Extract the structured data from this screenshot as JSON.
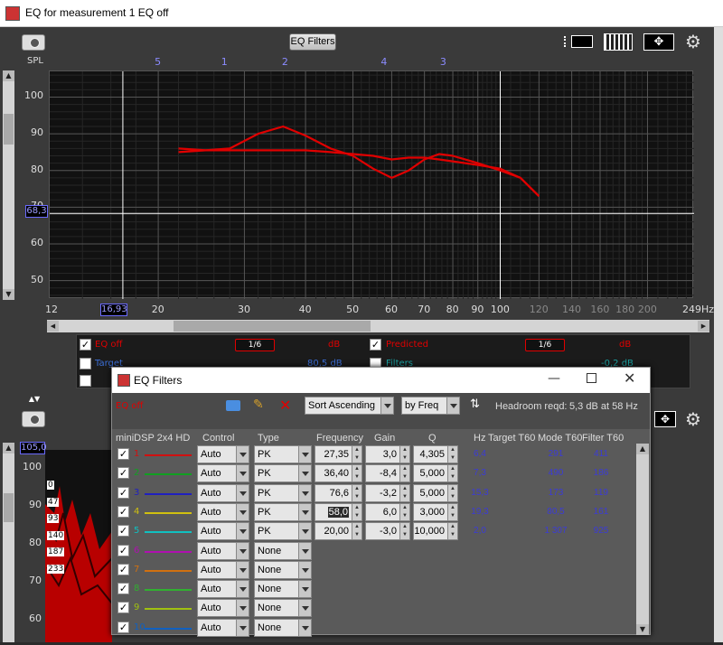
{
  "window": {
    "title": "EQ for measurement 1 EQ off"
  },
  "toolbar": {
    "eq_filters_label": "EQ Filters"
  },
  "graph": {
    "y_axis_title": "SPL",
    "y_ticks": [
      "100",
      "90",
      "80",
      "70",
      "60",
      "50"
    ],
    "x_ticks": [
      "12",
      "20",
      "30",
      "40",
      "50",
      "60",
      "70",
      "80",
      "90",
      "100",
      "120",
      "140",
      "160",
      "180",
      "200",
      "249Hz"
    ],
    "cursor_x_label": "16,93",
    "cursor_y_label": "68,3",
    "filter_markers": [
      "5",
      "1",
      "2",
      "4",
      "3"
    ],
    "colors": {
      "eq_off": "#e00000",
      "predicted": "#e00000",
      "cursor": "#ffffff",
      "markers": "#8b8bff"
    }
  },
  "chart_data": {
    "type": "line",
    "xlabel": "",
    "ylabel": "SPL",
    "xscale": "log",
    "xlim": [
      12,
      249
    ],
    "ylim": [
      45,
      107
    ],
    "grid": true,
    "series": [
      {
        "name": "EQ off",
        "x": [
          22,
          25,
          28,
          32,
          36,
          40,
          45,
          50,
          55,
          60,
          65,
          70,
          75,
          80,
          90,
          100,
          110,
          120
        ],
        "y": [
          86,
          85.5,
          86,
          90,
          92,
          89.5,
          86,
          84,
          80.5,
          78,
          80,
          83,
          84.5,
          84,
          82,
          80,
          78,
          73
        ]
      },
      {
        "name": "Predicted",
        "x": [
          22,
          25,
          28,
          32,
          36,
          40,
          45,
          50,
          55,
          60,
          65,
          70,
          75,
          80,
          90,
          100,
          110,
          120
        ],
        "y": [
          85,
          85.5,
          85.5,
          85.5,
          85.5,
          85.5,
          85,
          84.5,
          84,
          83,
          83.5,
          83.5,
          83,
          82.5,
          81.5,
          80.5,
          78,
          73
        ]
      }
    ]
  },
  "legend": {
    "eq_off_label": "EQ off",
    "eq_off_smoothing": "1/6",
    "eq_off_unit": "dB",
    "predicted_label": "Predicted",
    "predicted_smoothing": "1/6",
    "predicted_unit": "dB",
    "target_label": "Target",
    "target_value": "80,5 dB",
    "filters_label": "Filters",
    "filters_value": "-0,2 dB"
  },
  "lower_graph": {
    "y_ticks": [
      "100",
      "90",
      "80",
      "70",
      "60"
    ],
    "cursor_y_label": "105,0",
    "side_values": [
      "0",
      "47",
      "93",
      "140",
      "187",
      "233"
    ]
  },
  "dialog": {
    "title": "EQ Filters",
    "measurement": "EQ off",
    "sort_select": "Sort Ascending",
    "sort_by_select": "by Freq",
    "headroom_label": "Headroom reqd:",
    "headroom_value": "5,3 dB at 58 Hz",
    "columns": {
      "device": "miniDSP 2x4 HD",
      "control": "Control",
      "type": "Type",
      "frequency": "Frequency",
      "gain": "Gain",
      "q": "Q",
      "hz": "Hz",
      "target_t60": "Target T60",
      "mode_t60": "Mode T60",
      "filter_t60": "Filter T60"
    },
    "rows": [
      {
        "num": "1",
        "color": "#d01010",
        "control": "Auto",
        "type": "PK",
        "freq": "27,35",
        "gain": "3,0",
        "q": "4,305",
        "hz": "6,4",
        "mode": "291",
        "filter": "411"
      },
      {
        "num": "2",
        "color": "#10a020",
        "control": "Auto",
        "type": "PK",
        "freq": "36,40",
        "gain": "-8,4",
        "q": "5,000",
        "hz": "7,3",
        "mode": "490",
        "filter": "186"
      },
      {
        "num": "3",
        "color": "#2020c0",
        "control": "Auto",
        "type": "PK",
        "freq": "76,6",
        "gain": "-3,2",
        "q": "5,000",
        "hz": "15,3",
        "mode": "173",
        "filter": "119"
      },
      {
        "num": "4",
        "color": "#d0c010",
        "control": "Auto",
        "type": "PK",
        "freq": "58,0",
        "gain": "6,0",
        "q": "3,000",
        "hz": "19,3",
        "mode": "80,5",
        "filter": "161"
      },
      {
        "num": "5",
        "color": "#10c0c0",
        "control": "Auto",
        "type": "PK",
        "freq": "20,00",
        "gain": "-3,0",
        "q": "10,000",
        "hz": "2,0",
        "mode": "1 307",
        "filter": "925"
      },
      {
        "num": "6",
        "color": "#b010b0",
        "control": "Auto",
        "type": "None"
      },
      {
        "num": "7",
        "color": "#d07010",
        "control": "Auto",
        "type": "None"
      },
      {
        "num": "8",
        "color": "#30b030",
        "control": "Auto",
        "type": "None"
      },
      {
        "num": "9",
        "color": "#a0c010",
        "control": "Auto",
        "type": "None"
      },
      {
        "num": "10",
        "color": "#1060c0",
        "control": "Auto",
        "type": "None"
      }
    ]
  }
}
